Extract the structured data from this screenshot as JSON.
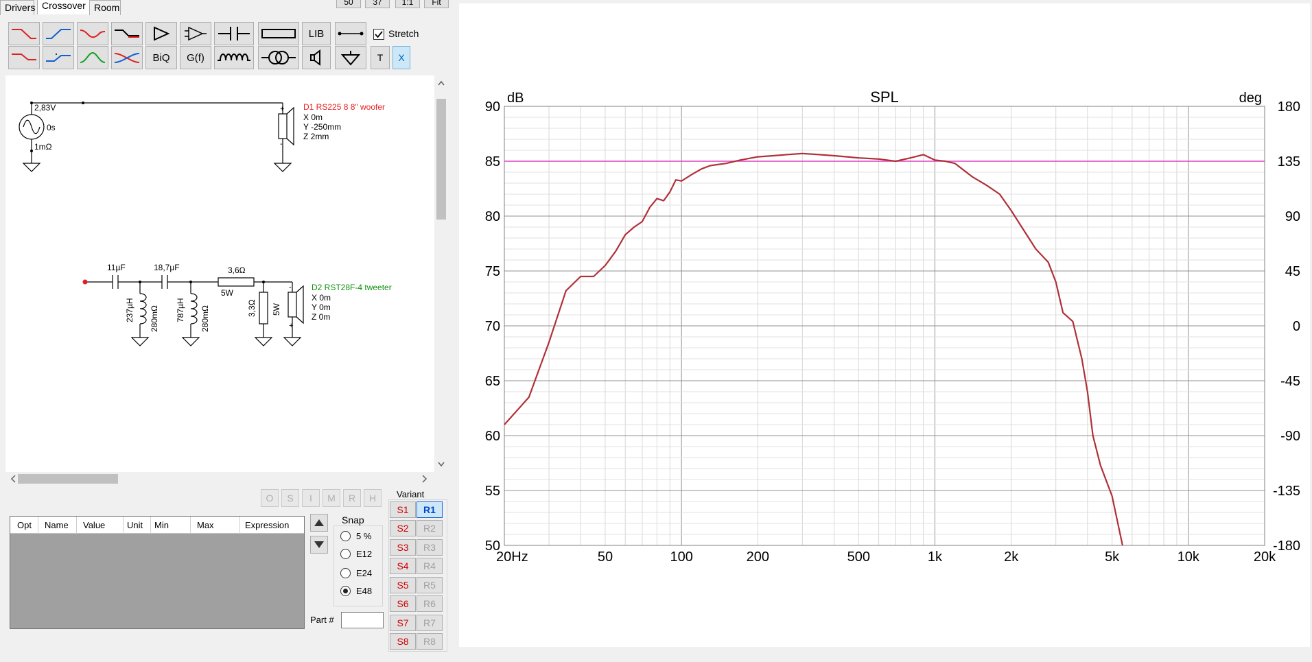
{
  "tabs": [
    "Drivers",
    "Crossover",
    "Room"
  ],
  "active_tab": "Crossover",
  "top_buttons": [
    "50",
    "37",
    "1:1",
    "Fit"
  ],
  "toolbar": {
    "lib_label": "LIB",
    "stretch_label": "Stretch",
    "stretch_checked": true,
    "biq_label": "BiQ",
    "gf_label": "G(f)",
    "t_label": "T",
    "x_label": "X"
  },
  "schematic": {
    "source": {
      "voltage": "2,83V",
      "delay": "0s",
      "resistance": "1mΩ"
    },
    "driver1": {
      "name": "D1 RS225 8 8\" woofer",
      "x": "X 0m",
      "y": "Y -250mm",
      "z": "Z 2mm",
      "color": "#e82020"
    },
    "driver2": {
      "name": "D2 RST28F-4 tweeter",
      "x": "X 0m",
      "y": "Y 0m",
      "z": "Z 0m",
      "color": "#109010"
    },
    "components": {
      "c1": "11µF",
      "c2": "18,7µF",
      "l1": "237µH",
      "l1r": "280mΩ",
      "l2": "787µH",
      "l2r": "280mΩ",
      "r1": "3,6Ω",
      "r1w": "5W",
      "r2": "3,3Ω",
      "r2w": "5W"
    }
  },
  "opt_buttons": [
    "O",
    "S",
    "I",
    "M",
    "R",
    "H"
  ],
  "opt_table_headers": [
    "Opt",
    "Name",
    "Value",
    "Unit",
    "Min",
    "Max",
    "Expression"
  ],
  "snap": {
    "title": "Snap",
    "options": [
      "5 %",
      "E12",
      "E24",
      "E48"
    ],
    "selected": "E48"
  },
  "part_label": "Part #",
  "part_value": "",
  "variant": {
    "title": "Variant",
    "s": [
      "S1",
      "S2",
      "S3",
      "S4",
      "S5",
      "S6",
      "S7",
      "S8"
    ],
    "r": [
      "R1",
      "R2",
      "R3",
      "R4",
      "R5",
      "R6",
      "R7",
      "R8"
    ],
    "active_r": "R1"
  },
  "graph": {
    "title": "SPL",
    "left_unit": "dB",
    "right_unit": "deg"
  },
  "chart_data": {
    "type": "line",
    "title": "SPL",
    "ylabel": "dB",
    "y2label": "deg",
    "x_scale": "log",
    "xlim": [
      20,
      20000
    ],
    "ylim": [
      50,
      90
    ],
    "y2lim": [
      -180,
      180
    ],
    "x_ticks": [
      {
        "value": 20,
        "label": "20Hz"
      },
      {
        "value": 50,
        "label": "50"
      },
      {
        "value": 100,
        "label": "100"
      },
      {
        "value": 200,
        "label": "200"
      },
      {
        "value": 500,
        "label": "500"
      },
      {
        "value": 1000,
        "label": "1k"
      },
      {
        "value": 2000,
        "label": "2k"
      },
      {
        "value": 5000,
        "label": "5k"
      },
      {
        "value": 10000,
        "label": "10k"
      },
      {
        "value": 20000,
        "label": "20k"
      }
    ],
    "y_ticks": [
      90,
      85,
      80,
      75,
      70,
      65,
      60,
      55,
      50
    ],
    "y2_ticks": [
      180,
      135,
      90,
      45,
      0,
      -45,
      -90,
      -135,
      -180
    ],
    "grid": true,
    "reference_line": {
      "y": 85,
      "color": "#e040c0"
    },
    "series": [
      {
        "color": "#b03038",
        "x": [
          20,
          25,
          30,
          35,
          40,
          45,
          50,
          55,
          60,
          65,
          70,
          75,
          80,
          85,
          90,
          95,
          100,
          110,
          120,
          130,
          150,
          170,
          200,
          230,
          260,
          300,
          350,
          400,
          450,
          500,
          600,
          700,
          800,
          900,
          1000,
          1100,
          1200,
          1400,
          1600,
          1800,
          2000,
          2200,
          2500,
          2800,
          3000,
          3200,
          3500,
          3800,
          4000,
          4200,
          4500,
          5000,
          5500
        ],
        "y": [
          61,
          63.5,
          68.5,
          73.2,
          74.5,
          74.5,
          75.5,
          76.8,
          78.3,
          79,
          79.5,
          80.8,
          81.6,
          81.4,
          82.2,
          83.3,
          83.2,
          83.8,
          84.3,
          84.6,
          84.8,
          85.1,
          85.4,
          85.5,
          85.6,
          85.7,
          85.6,
          85.5,
          85.4,
          85.3,
          85.2,
          85.0,
          85.3,
          85.6,
          85.1,
          85.0,
          84.8,
          83.6,
          82.8,
          82.0,
          80.5,
          79.0,
          77.0,
          75.8,
          74.0,
          71.2,
          70.4,
          67.0,
          64.0,
          60.0,
          57.3,
          54.5,
          50
        ]
      }
    ]
  }
}
